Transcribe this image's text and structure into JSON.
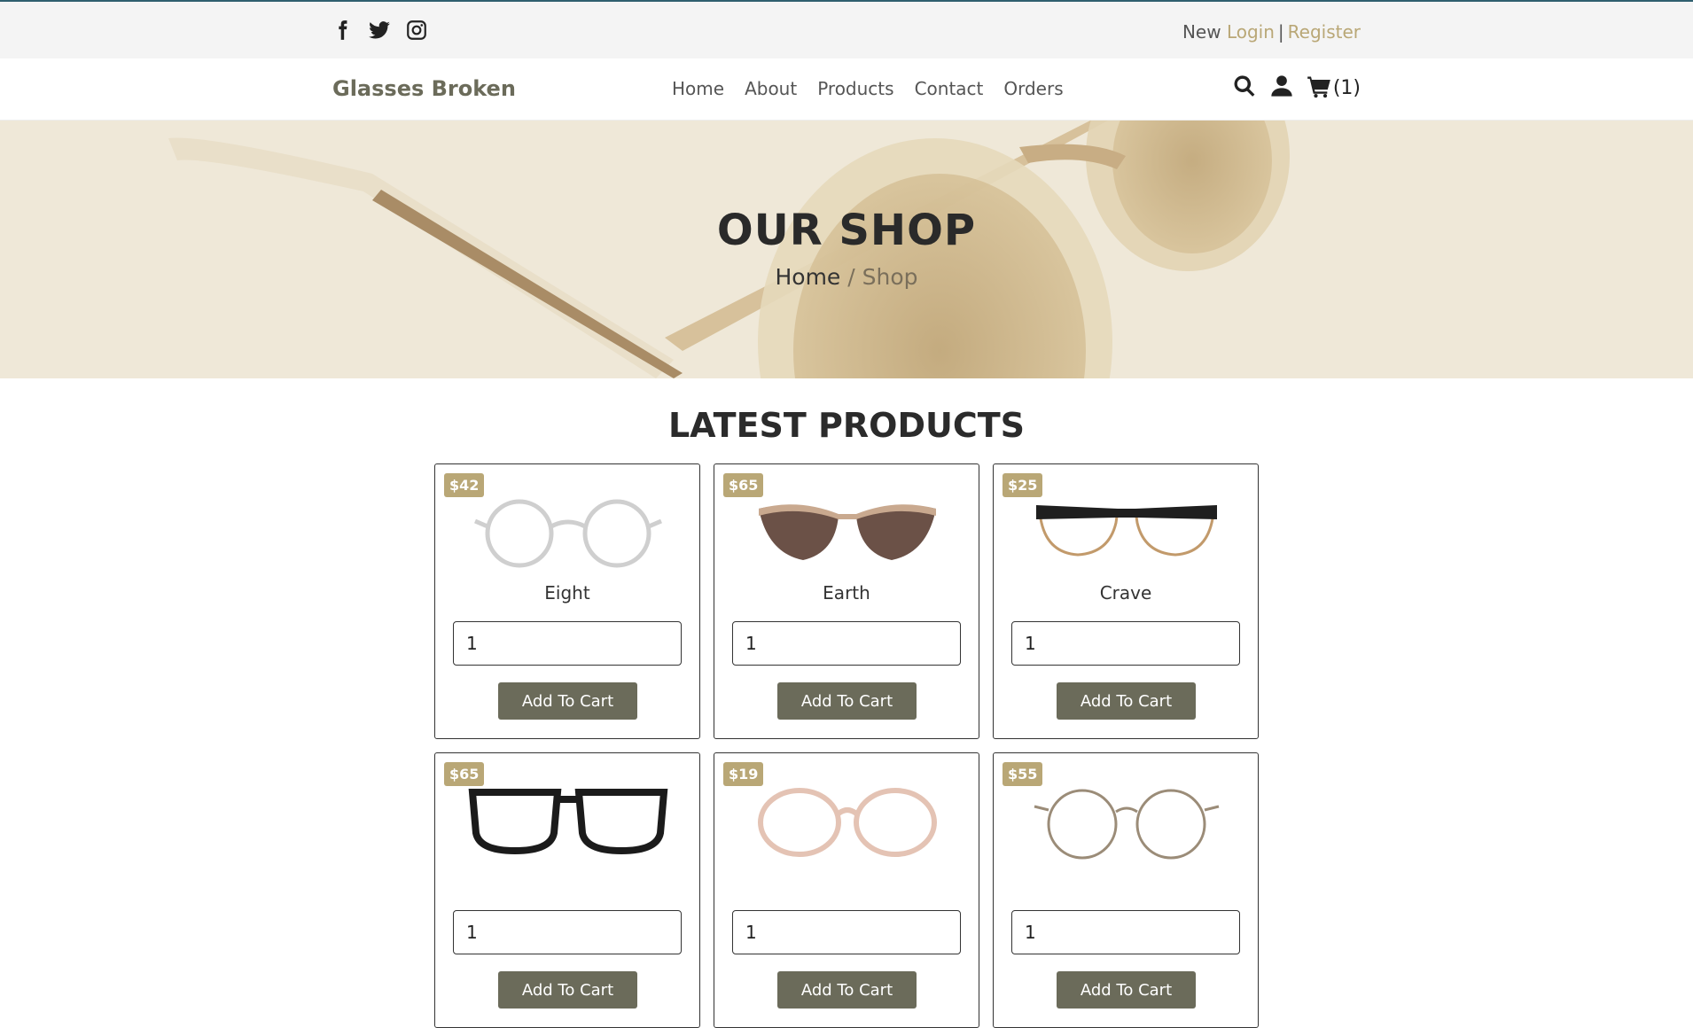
{
  "header": {
    "social": [
      "facebook-icon",
      "twitter-icon",
      "instagram-icon"
    ],
    "auth": {
      "new": "New",
      "login": "Login",
      "separator": "|",
      "register": "Register"
    }
  },
  "nav": {
    "brand": "Glasses Broken",
    "items": [
      "Home",
      "About",
      "Products",
      "Contact",
      "Orders"
    ],
    "cart_count": "(1)"
  },
  "hero": {
    "title": "OUR SHOP",
    "breadcrumb": {
      "home": "Home",
      "separator": "/",
      "current": "Shop"
    }
  },
  "section": {
    "title": "LATEST PRODUCTS"
  },
  "products": [
    {
      "price": "$42",
      "name": "Eight",
      "qty": "1",
      "button": "Add To Cart"
    },
    {
      "price": "$65",
      "name": "Earth",
      "qty": "1",
      "button": "Add To Cart"
    },
    {
      "price": "$25",
      "name": "Crave",
      "qty": "1",
      "button": "Add To Cart"
    },
    {
      "price": "$65",
      "name": "",
      "qty": "1",
      "button": "Add To Cart"
    },
    {
      "price": "$19",
      "name": "",
      "qty": "1",
      "button": "Add To Cart"
    },
    {
      "price": "$55",
      "name": "",
      "qty": "1",
      "button": "Add To Cart"
    }
  ],
  "colors": {
    "accent": "#b9a776",
    "button": "#6b6b5a",
    "topbar": "#f4f4f4"
  }
}
